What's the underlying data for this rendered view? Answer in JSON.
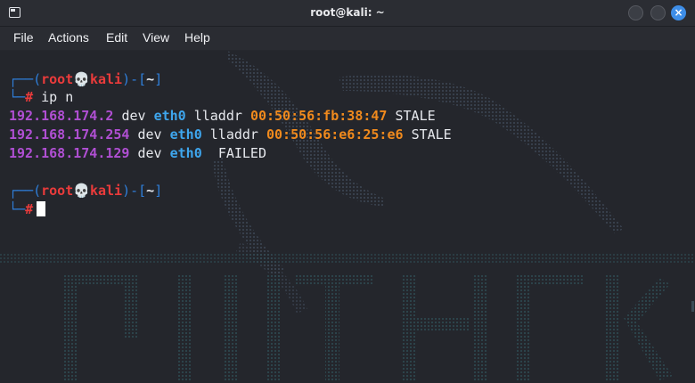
{
  "window": {
    "title": "root@kali: ~"
  },
  "menu": [
    "File",
    "Actions",
    "Edit",
    "View",
    "Help"
  ],
  "prompt": {
    "open": "┌──(",
    "user": "root",
    "skull": "💀",
    "host": "kali",
    "mid": ")-[",
    "dir": "~",
    "close": "]",
    "corner": "└─",
    "hash": "#"
  },
  "command": "ip n",
  "neighbors": [
    {
      "ip": "192.168.174.2",
      "dev_kw": "dev",
      "iface": "eth0",
      "lladdr_kw": "lladdr",
      "mac": "00:50:56:fb:38:47",
      "state": "STALE"
    },
    {
      "ip": "192.168.174.254",
      "dev_kw": "dev",
      "iface": "eth0",
      "lladdr_kw": "lladdr",
      "mac": "00:50:56:e6:25:e6",
      "state": "STALE"
    },
    {
      "ip": "192.168.174.129",
      "dev_kw": "dev",
      "iface": "eth0",
      "lladdr_kw": "",
      "mac": "",
      "state": "FAILED"
    }
  ],
  "colors": {
    "prompt_frame": "#2f7fdb",
    "prompt_user": "#ea3b3b",
    "ip": "#b04fd3",
    "iface": "#3ea6ee",
    "mac": "#f08a1d",
    "close_button": "#3e8ee8"
  },
  "icons": {
    "app": "terminal-icon",
    "minimize": "minimize-icon",
    "maximize": "maximize-icon",
    "close": "close-icon"
  }
}
